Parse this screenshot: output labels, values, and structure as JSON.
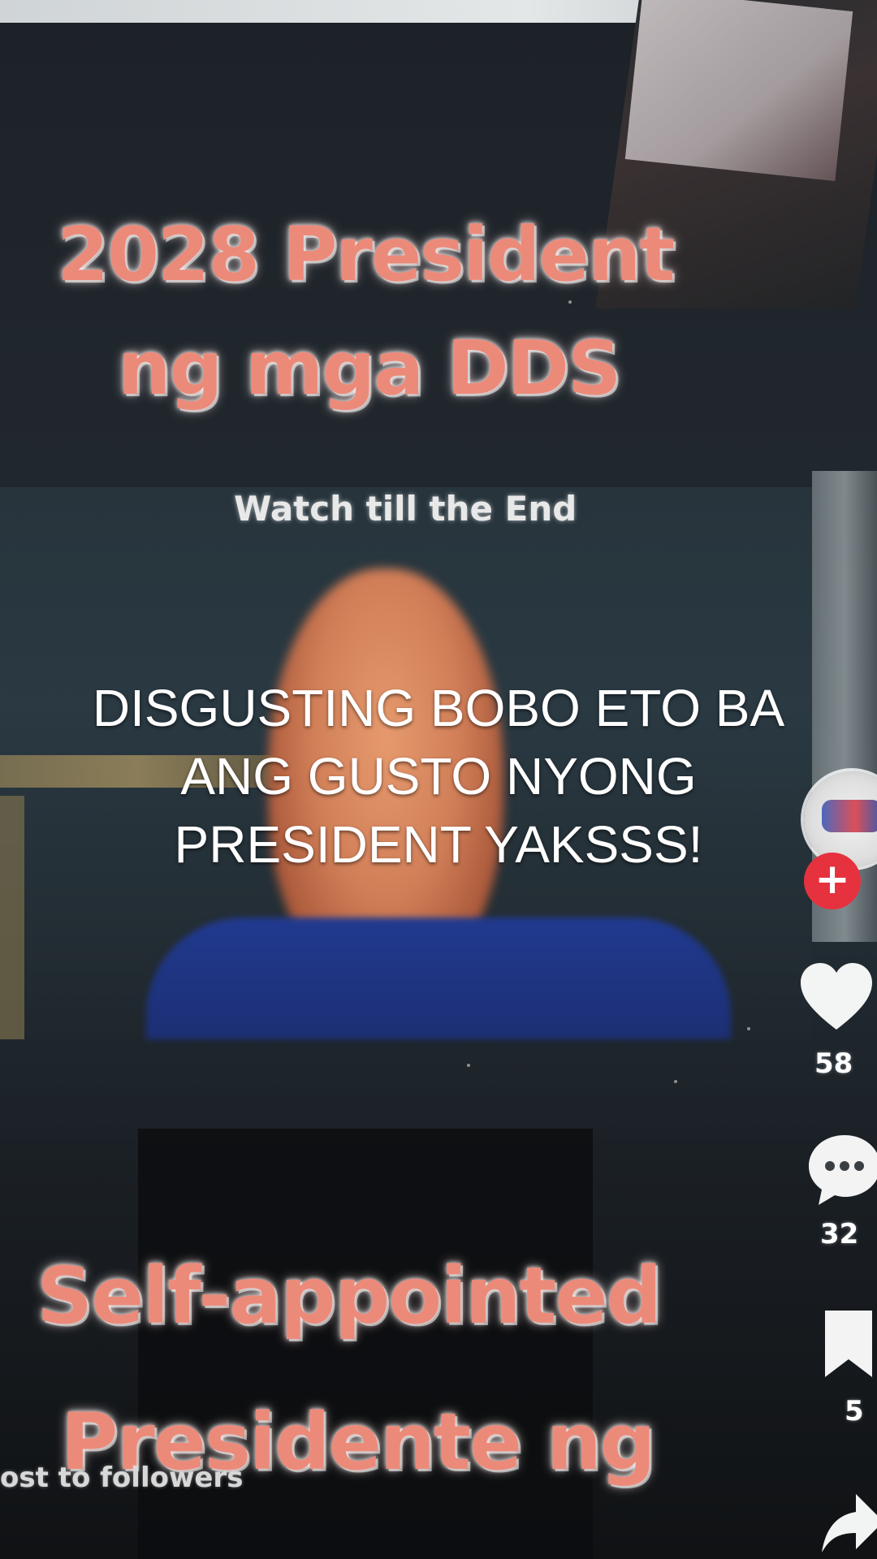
{
  "overlay": {
    "top_headline_line1": "2028 President",
    "top_headline_line2": "ng mga DDS",
    "subtitle": "Watch till the End",
    "caption": "DISGUSTING BOBO ETO BA ANG GUSTO NYONG PRESIDENT YAKSSS!",
    "bottom_headline_line1": "Self-appointed",
    "bottom_headline_line2": "Presidente ng"
  },
  "background_screen": {
    "post_to_followers": "ost to followers",
    "likes_count": "58",
    "comments_count": "32",
    "saves_count": "5",
    "icons": [
      "heart-icon",
      "comment-icon",
      "bookmark-icon",
      "share-icon",
      "follow-plus-icon"
    ]
  },
  "colors": {
    "headline": "#ec8a7a",
    "caption": "#ffffff",
    "follow_button": "#e6313f"
  }
}
